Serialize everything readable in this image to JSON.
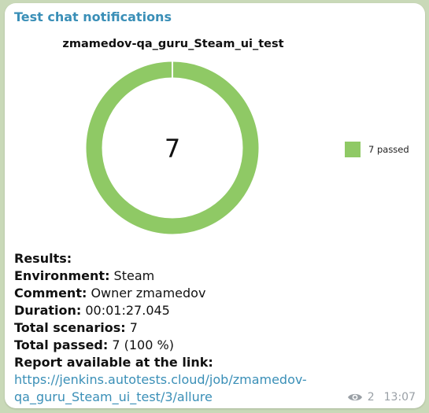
{
  "message": {
    "chat_title": "Test chat notifications",
    "report_title": "zmamedov-qa_guru_Steam_ui_test",
    "donut_center_value": "7",
    "legend": [
      {
        "label": "7 passed",
        "color": "#8fc965"
      }
    ],
    "chart_data": {
      "type": "pie",
      "categories": [
        "passed"
      ],
      "values": [
        7
      ],
      "title": "zmamedov-qa_guru_Steam_ui_test",
      "legend": "right"
    },
    "results": {
      "heading": "Results:",
      "environment_label": "Environment:",
      "environment_value": " Steam",
      "comment_label": "Comment:",
      "comment_value": " Owner zmamedov",
      "duration_label": "Duration:",
      "duration_value": " 00:01:27.045",
      "total_scenarios_label": "Total scenarios:",
      "total_scenarios_value": " 7",
      "total_passed_label": "Total passed:",
      "total_passed_value": " 7 (100 %)",
      "report_label": "Report available at the link:",
      "report_link_line1": "https://jenkins.autotests.cloud/job/zmamedov-",
      "report_link_line2": "qa_guru_Steam_ui_test/3/allure"
    },
    "views_count": "2",
    "time": "13:07",
    "colors": {
      "accent": "#3a8fb7",
      "passed": "#8fc965"
    }
  }
}
